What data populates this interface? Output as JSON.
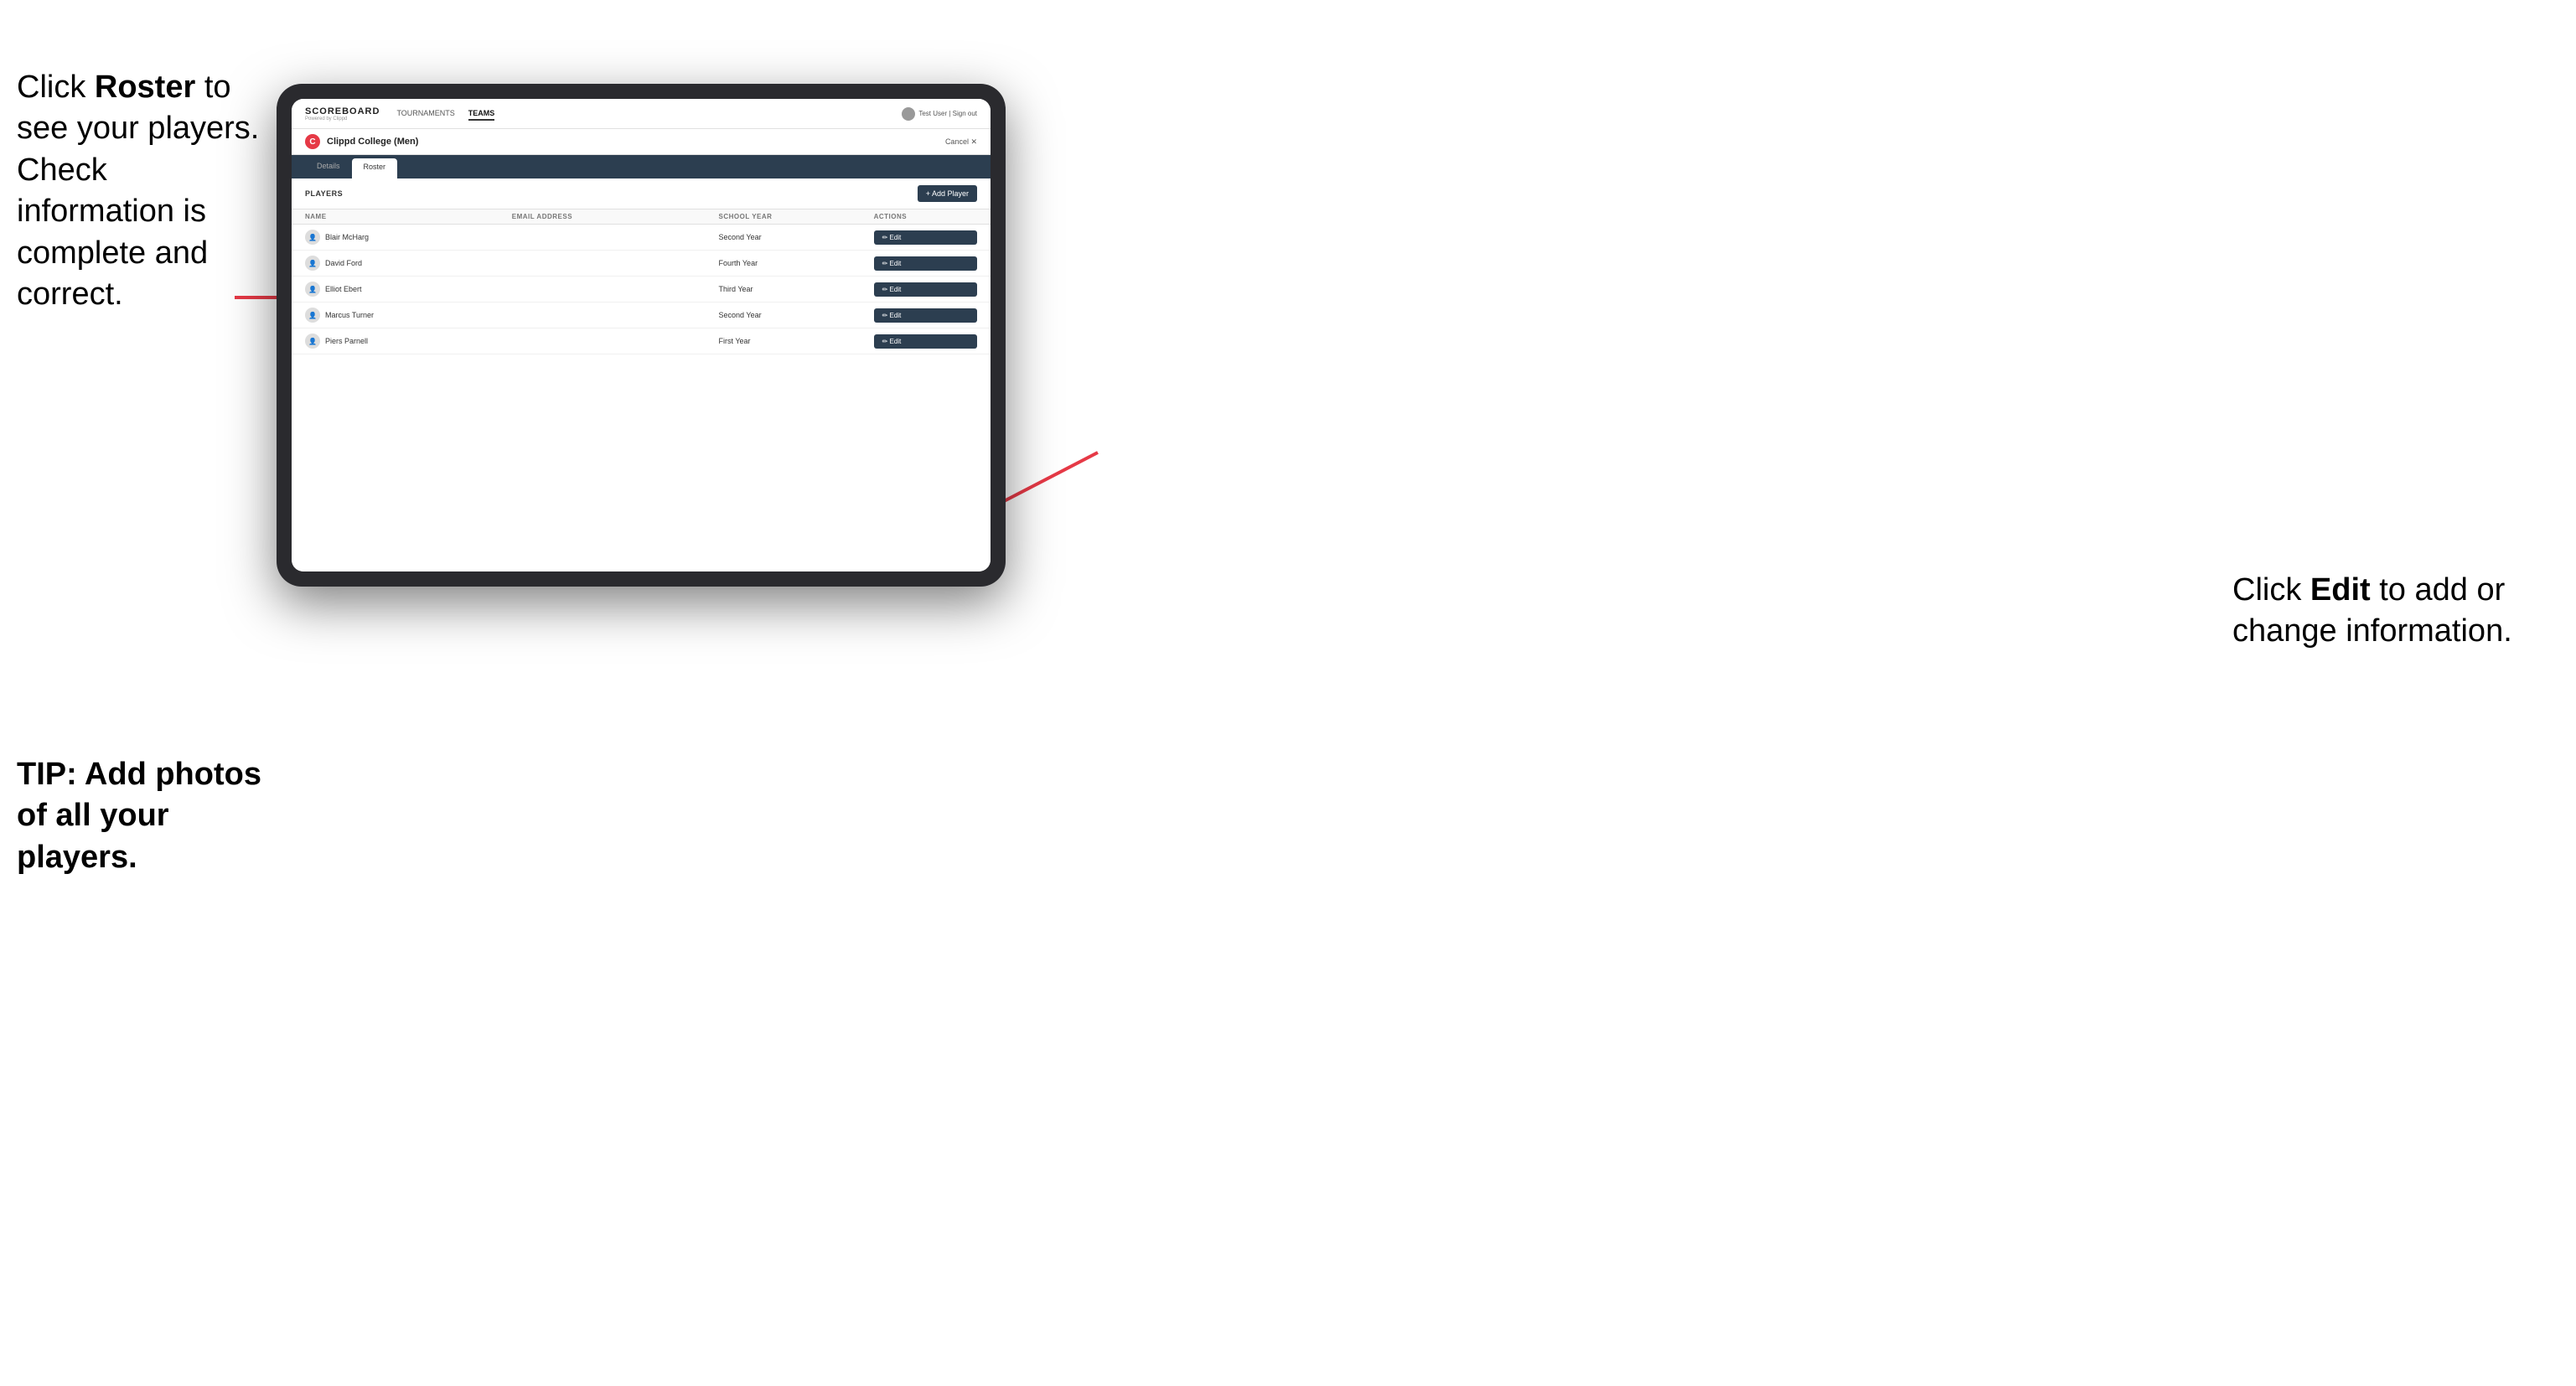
{
  "instructions": {
    "left_text_part1": "Click ",
    "left_text_bold": "Roster",
    "left_text_part2": " to see your players. Check information is complete and correct.",
    "tip_text": "TIP: Add photos of all your players.",
    "right_text_part1": "Click ",
    "right_text_bold": "Edit",
    "right_text_part2": " to add or change information."
  },
  "header": {
    "logo_title": "SCOREBOARD",
    "logo_sub": "Powered by Clippd",
    "nav": [
      {
        "label": "TOURNAMENTS",
        "active": false
      },
      {
        "label": "TEAMS",
        "active": true
      }
    ],
    "user_text": "Test User | Sign out"
  },
  "team": {
    "logo_letter": "C",
    "name": "Clippd College (Men)",
    "cancel_label": "Cancel ✕"
  },
  "tabs": [
    {
      "label": "Details",
      "active": false
    },
    {
      "label": "Roster",
      "active": true
    }
  ],
  "players_section": {
    "section_label": "PLAYERS",
    "add_player_label": "+ Add Player"
  },
  "table": {
    "columns": [
      "NAME",
      "EMAIL ADDRESS",
      "SCHOOL YEAR",
      "ACTIONS"
    ],
    "rows": [
      {
        "name": "Blair McHarg",
        "email": "",
        "school_year": "Second Year"
      },
      {
        "name": "David Ford",
        "email": "",
        "school_year": "Fourth Year"
      },
      {
        "name": "Elliot Ebert",
        "email": "",
        "school_year": "Third Year"
      },
      {
        "name": "Marcus Turner",
        "email": "",
        "school_year": "Second Year"
      },
      {
        "name": "Piers Parnell",
        "email": "",
        "school_year": "First Year"
      }
    ],
    "edit_label": "✏ Edit"
  },
  "colors": {
    "dark_nav": "#2c3e50",
    "accent_red": "#e63946",
    "btn_dark": "#2c3e50"
  }
}
